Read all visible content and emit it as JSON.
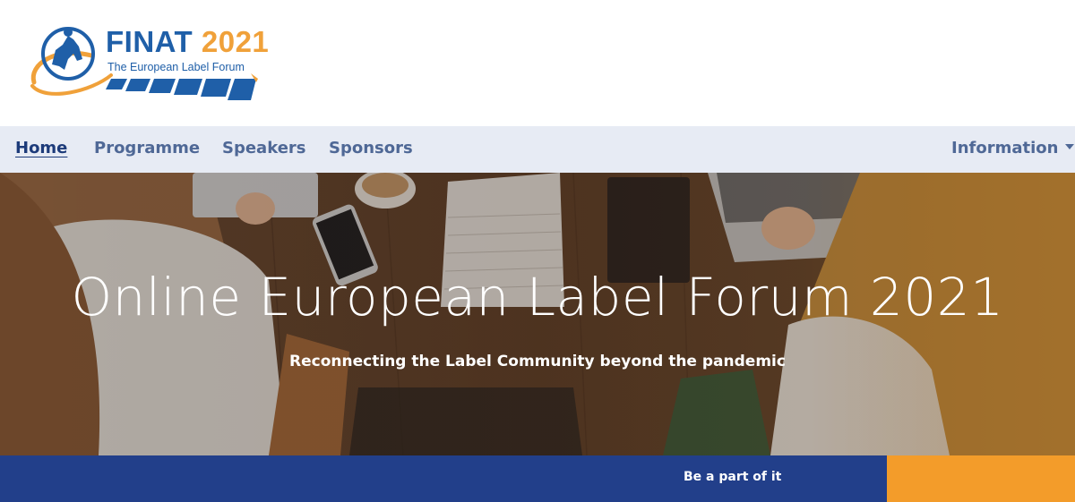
{
  "logo": {
    "title_part1": "FINAT",
    "title_part2": "2021",
    "subtitle": "The European Label Forum",
    "colors": {
      "blue": "#1f5fa8",
      "orange": "#f0a13a"
    }
  },
  "nav": {
    "items": [
      {
        "label": "Home",
        "active": true
      },
      {
        "label": "Programme"
      },
      {
        "label": "Speakers"
      },
      {
        "label": "Sponsors"
      }
    ],
    "dropdown": {
      "label": "Information",
      "icon": "caret-down-icon"
    }
  },
  "hero": {
    "title": "Online European Label Forum 2021",
    "subtitle": "Reconnecting the Label Community beyond the pandemic"
  },
  "cta": {
    "label": "Be a part of it",
    "colors": {
      "bar": "#223f8a",
      "accent": "#f39c2a"
    }
  }
}
